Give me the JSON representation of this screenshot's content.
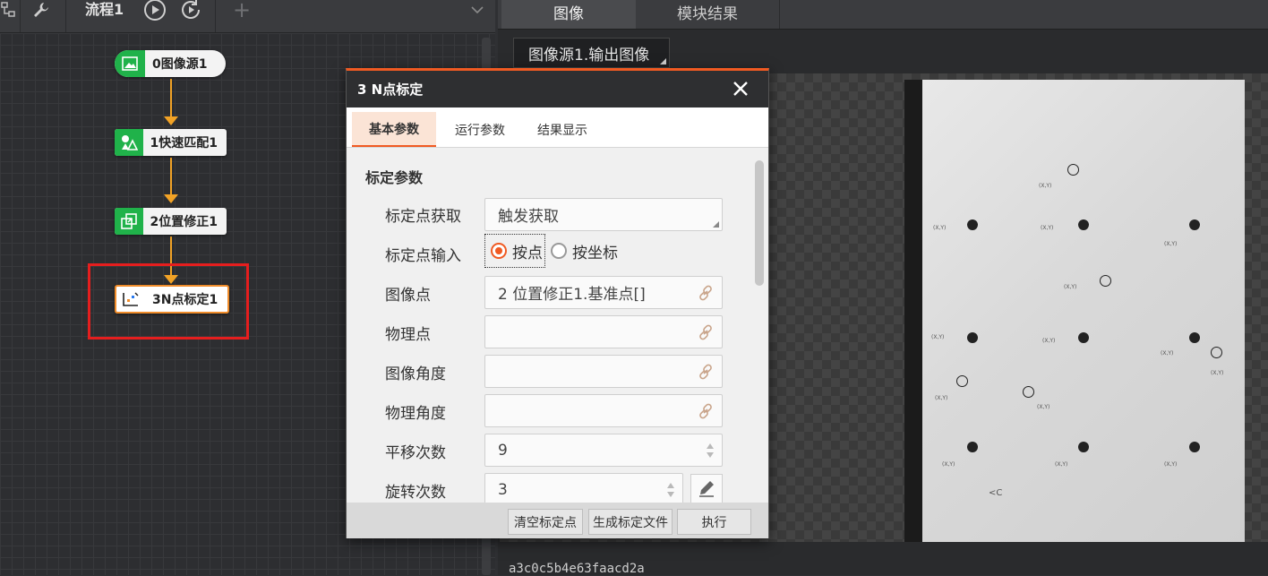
{
  "flow": {
    "title": "流程1",
    "add_symbol": "+",
    "nodes": [
      {
        "label": "0图像源1"
      },
      {
        "label": "1快速匹配1"
      },
      {
        "label": "2位置修正1"
      },
      {
        "label": "3N点标定1"
      }
    ]
  },
  "right_panel": {
    "tabs": [
      "图像",
      "模块结果"
    ],
    "source_select": "图像源1.输出图像",
    "image_id": "a3c0c5b4e63faacd2a"
  },
  "dialog": {
    "title": "3 N点标定",
    "close_symbol": "✕",
    "tabs": [
      "基本参数",
      "运行参数",
      "结果显示"
    ],
    "section_title": "标定参数",
    "fields": {
      "point_source": {
        "label": "标定点获取",
        "value": "触发获取"
      },
      "point_input": {
        "label": "标定点输入",
        "options": [
          "按点",
          "按坐标"
        ],
        "selected": "按点"
      },
      "image_points": {
        "label": "图像点",
        "value": "2 位置修正1.基准点[]"
      },
      "physical_points": {
        "label": "物理点",
        "value": ""
      },
      "image_angle": {
        "label": "图像角度",
        "value": ""
      },
      "physical_angle": {
        "label": "物理角度",
        "value": ""
      },
      "translation_count": {
        "label": "平移次数",
        "value": "9"
      },
      "rotation_count": {
        "label": "旋转次数",
        "value": "3"
      }
    },
    "footer": {
      "clear_button": "清空标定点",
      "generate_button": "生成标定文件",
      "execute_button": "执行"
    }
  },
  "colors": {
    "accent": "#f05a22",
    "node_green": "#20b24a",
    "connector": "#f2a326",
    "highlight": "#e51e1e"
  }
}
